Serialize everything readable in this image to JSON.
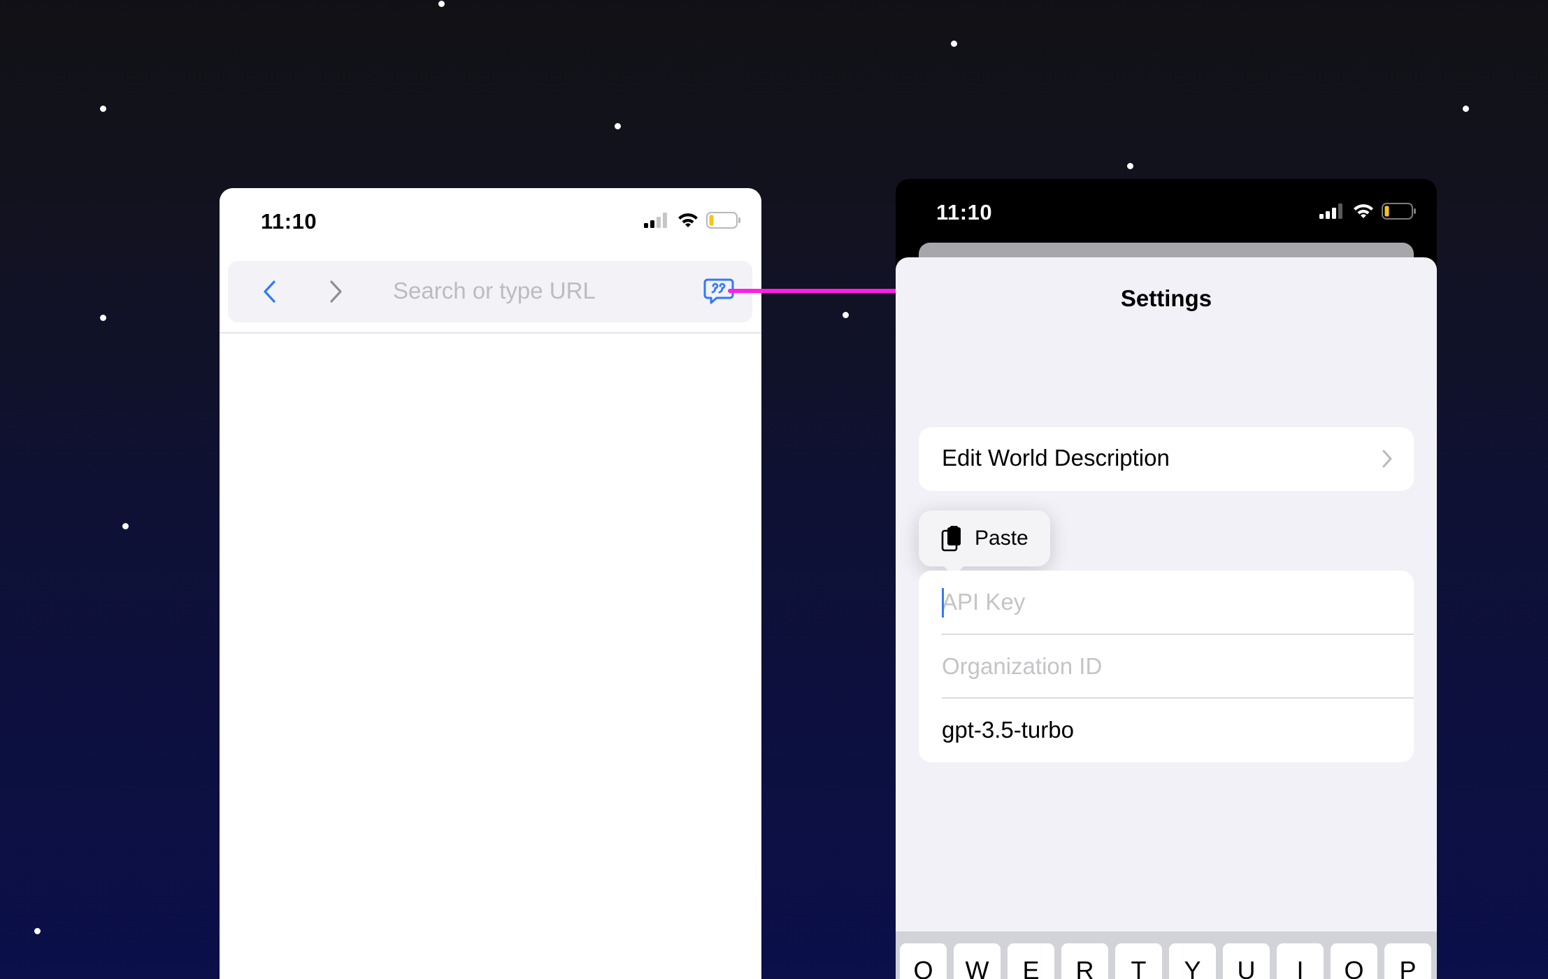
{
  "left_phone": {
    "status_time": "11:10",
    "url_placeholder": "Search or type URL",
    "icons": {
      "back": "chevron-left-icon",
      "forward": "chevron-right-icon",
      "action": "quote-bubble-icon"
    }
  },
  "right_phone": {
    "status_time": "11:10",
    "title": "Settings",
    "edit_world_label": "Edit World Description",
    "paste_label": "Paste",
    "fields": {
      "api_key_placeholder": "API Key",
      "org_id_placeholder": "Organization ID",
      "model_value": "gpt-3.5-turbo"
    },
    "keyboard_keys": [
      "Q",
      "W",
      "E",
      "R",
      "T",
      "Y",
      "U",
      "I",
      "O",
      "P"
    ]
  },
  "colors": {
    "accent_blue": "#3478f6",
    "arrow_magenta": "#ff1ee6",
    "battery_low": "#f5c518"
  }
}
